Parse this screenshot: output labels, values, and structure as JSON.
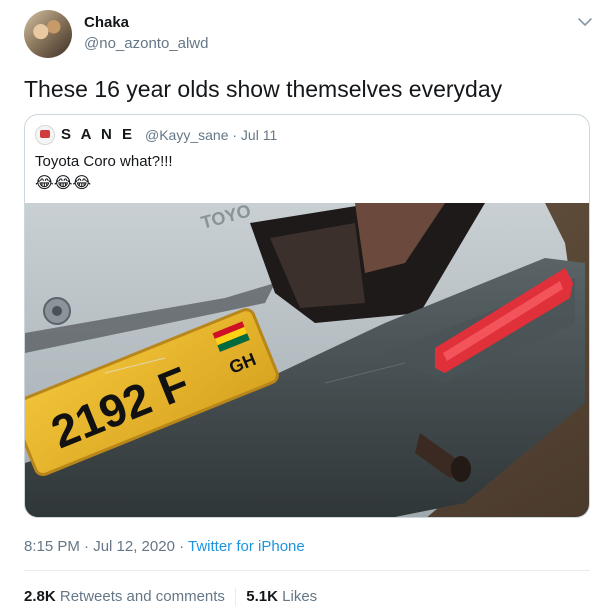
{
  "tweet": {
    "author_name": "Chaka",
    "author_handle": "@no_azonto_alwd",
    "text": "These 16 year olds show themselves everyday",
    "timestamp": "8:15 PM · Jul 12, 2020",
    "separator": " · ",
    "source": "Twitter for iPhone",
    "retweets_count": "2.8K",
    "retweets_label": "Retweets and comments",
    "likes_count": "5.1K",
    "likes_label": "Likes"
  },
  "quoted_tweet": {
    "author_name": "S A N E",
    "author_handle": "@Kayy_sane · Jul 11",
    "text": "Toyota Coro what?!!!",
    "emojis": "😂😂😂"
  },
  "photo": {
    "plate_text": "2192 F",
    "plate_region": "GH",
    "badge_text": "TOYO"
  },
  "icons": {
    "menu": "chevron-down-icon"
  }
}
